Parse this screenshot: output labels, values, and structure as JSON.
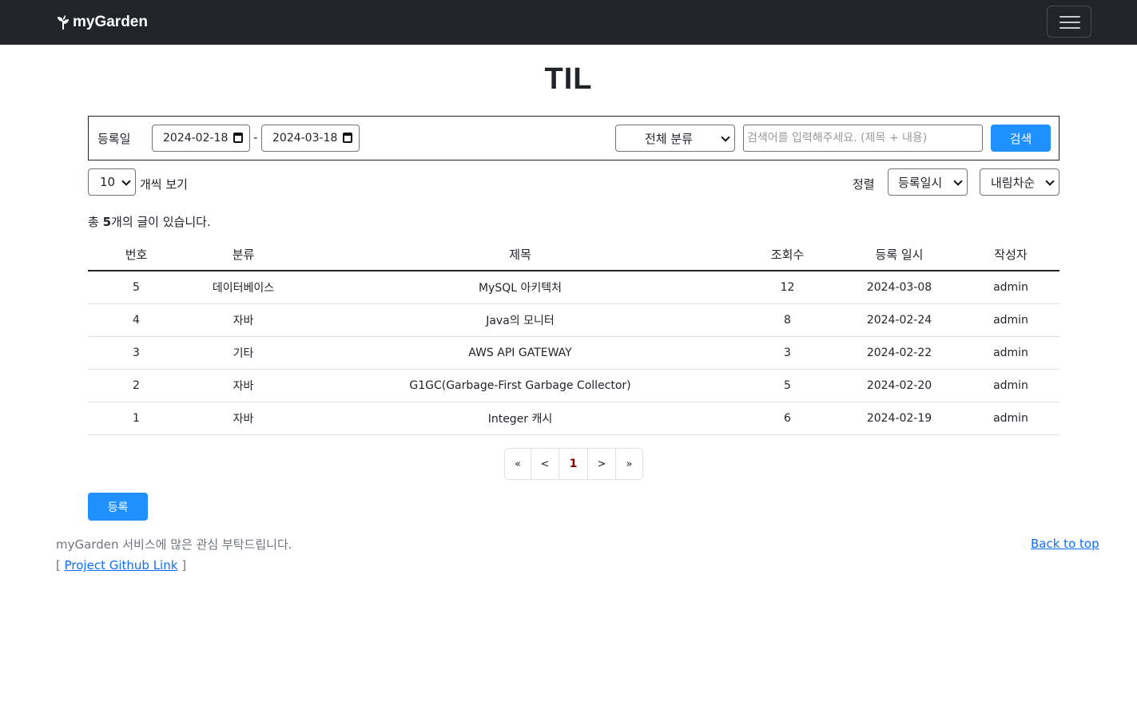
{
  "navbar": {
    "brand": "myGarden",
    "brand_icon": "plant-icon",
    "toggler_icon": "hamburger-menu-icon"
  },
  "page": {
    "title": "TIL"
  },
  "search": {
    "date_label": "등록일",
    "date_from": "2024-02-18",
    "date_to": "2024-03-18",
    "date_separator": "-",
    "category_selected": "전체 분류",
    "keyword_placeholder": "검색어를 입력해주세요. (제목 + 내용)",
    "keyword_value": "",
    "search_button": "검색"
  },
  "controls": {
    "page_size": "10",
    "page_size_label": "개씩 보기",
    "sort_label": "정렬",
    "sort_field": "등록일시",
    "sort_order": "내림차순"
  },
  "summary": {
    "prefix": "총 ",
    "count": "5",
    "suffix": "개의 글이 있습니다."
  },
  "table": {
    "headers": {
      "no": "번호",
      "category": "분류",
      "title": "제목",
      "views": "조회수",
      "date": "등록 일시",
      "author": "작성자"
    },
    "rows": [
      {
        "no": "5",
        "category": "데이터베이스",
        "title": "MySQL 아키텍처",
        "views": "12",
        "date": "2024-03-08",
        "author": "admin"
      },
      {
        "no": "4",
        "category": "자바",
        "title": "Java의 모니터",
        "views": "8",
        "date": "2024-02-24",
        "author": "admin"
      },
      {
        "no": "3",
        "category": "기타",
        "title": "AWS API GATEWAY",
        "views": "3",
        "date": "2024-02-22",
        "author": "admin"
      },
      {
        "no": "2",
        "category": "자바",
        "title": "G1GC(Garbage-First Garbage Collector)",
        "views": "5",
        "date": "2024-02-20",
        "author": "admin"
      },
      {
        "no": "1",
        "category": "자바",
        "title": "Integer 캐시",
        "views": "6",
        "date": "2024-02-19",
        "author": "admin"
      }
    ]
  },
  "pagination": {
    "first": "«",
    "prev": "<",
    "current": "1",
    "next": ">",
    "last": "»"
  },
  "actions": {
    "register_button": "등록"
  },
  "footer": {
    "message": "myGarden 서비스에 많은 관심 부탁드립니다.",
    "link_open": "[ ",
    "link_text": "Project Github Link",
    "link_close": " ]",
    "back_to_top": "Back to top"
  },
  "colors": {
    "navbar": "#212529",
    "primary_button": "#1e90ff",
    "active_page": "#8b0000",
    "link": "#0d6efd"
  }
}
